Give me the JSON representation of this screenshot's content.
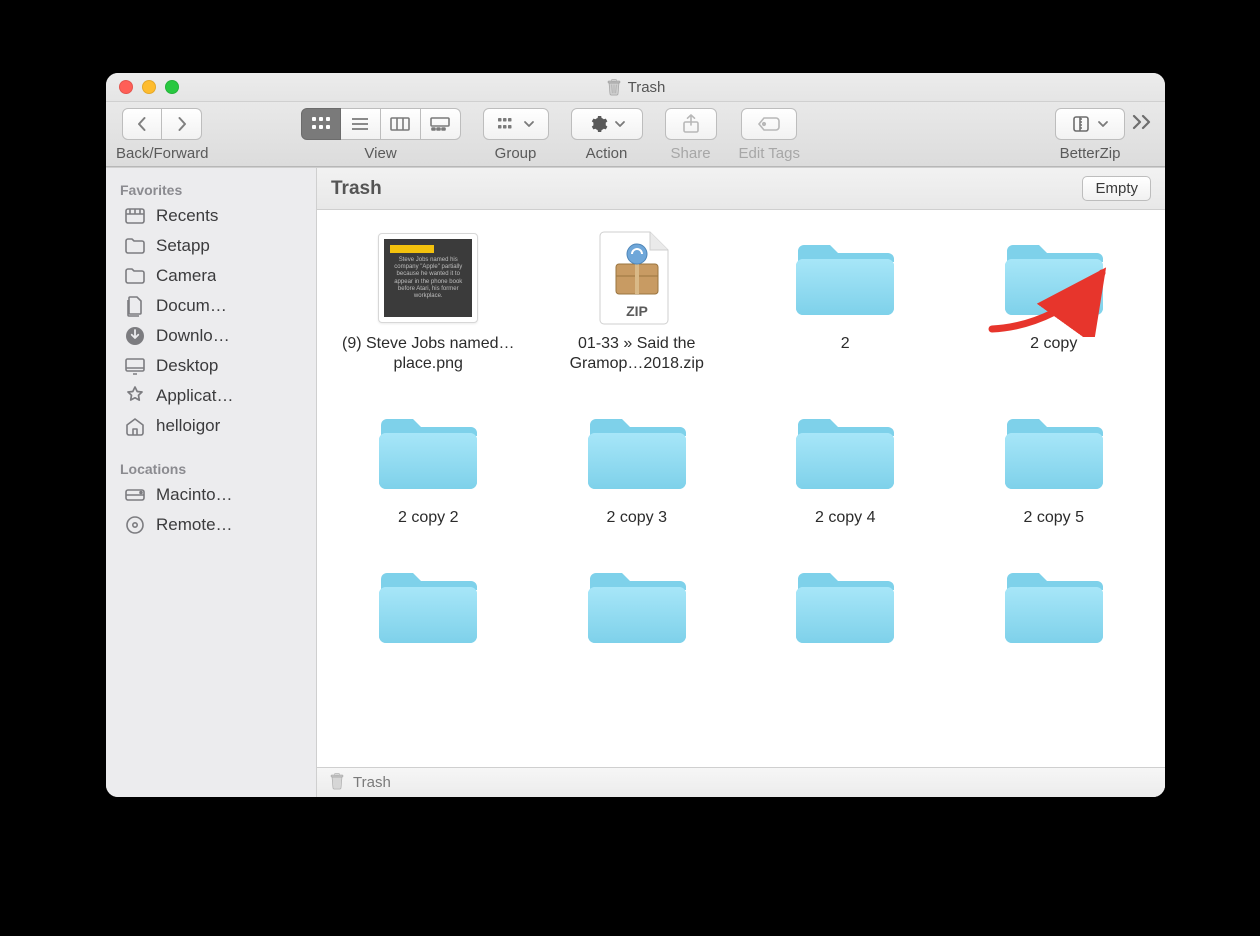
{
  "window": {
    "title": "Trash"
  },
  "toolbar": {
    "back_forward_label": "Back/Forward",
    "view_label": "View",
    "group_label": "Group",
    "action_label": "Action",
    "share_label": "Share",
    "edit_tags_label": "Edit Tags",
    "betterzip_label": "BetterZip"
  },
  "sidebar": {
    "section_favorites": "Favorites",
    "section_locations": "Locations",
    "favorites": [
      {
        "label": "Recents",
        "icon": "recents"
      },
      {
        "label": "Setapp",
        "icon": "folder"
      },
      {
        "label": "Camera",
        "icon": "folder"
      },
      {
        "label": "Docum…",
        "icon": "documents"
      },
      {
        "label": "Downlo…",
        "icon": "downloads"
      },
      {
        "label": "Desktop",
        "icon": "desktop"
      },
      {
        "label": "Applicat…",
        "icon": "applications"
      },
      {
        "label": "helloigor",
        "icon": "home"
      }
    ],
    "locations": [
      {
        "label": "Macinto…",
        "icon": "disk"
      },
      {
        "label": "Remote…",
        "icon": "disc"
      }
    ]
  },
  "header": {
    "path_title": "Trash",
    "empty_label": "Empty"
  },
  "items": [
    {
      "name": "(9) Steve Jobs named…place.png",
      "kind": "png"
    },
    {
      "name": "01-33 » Said the Gramop…2018.zip",
      "kind": "zip"
    },
    {
      "name": "2",
      "kind": "folder"
    },
    {
      "name": "2 copy",
      "kind": "folder"
    },
    {
      "name": "2 copy 2",
      "kind": "folder"
    },
    {
      "name": "2 copy 3",
      "kind": "folder"
    },
    {
      "name": "2 copy 4",
      "kind": "folder"
    },
    {
      "name": "2 copy 5",
      "kind": "folder"
    },
    {
      "name": "",
      "kind": "folder"
    },
    {
      "name": "",
      "kind": "folder"
    },
    {
      "name": "",
      "kind": "folder"
    },
    {
      "name": "",
      "kind": "folder"
    }
  ],
  "status": {
    "path": "Trash"
  }
}
